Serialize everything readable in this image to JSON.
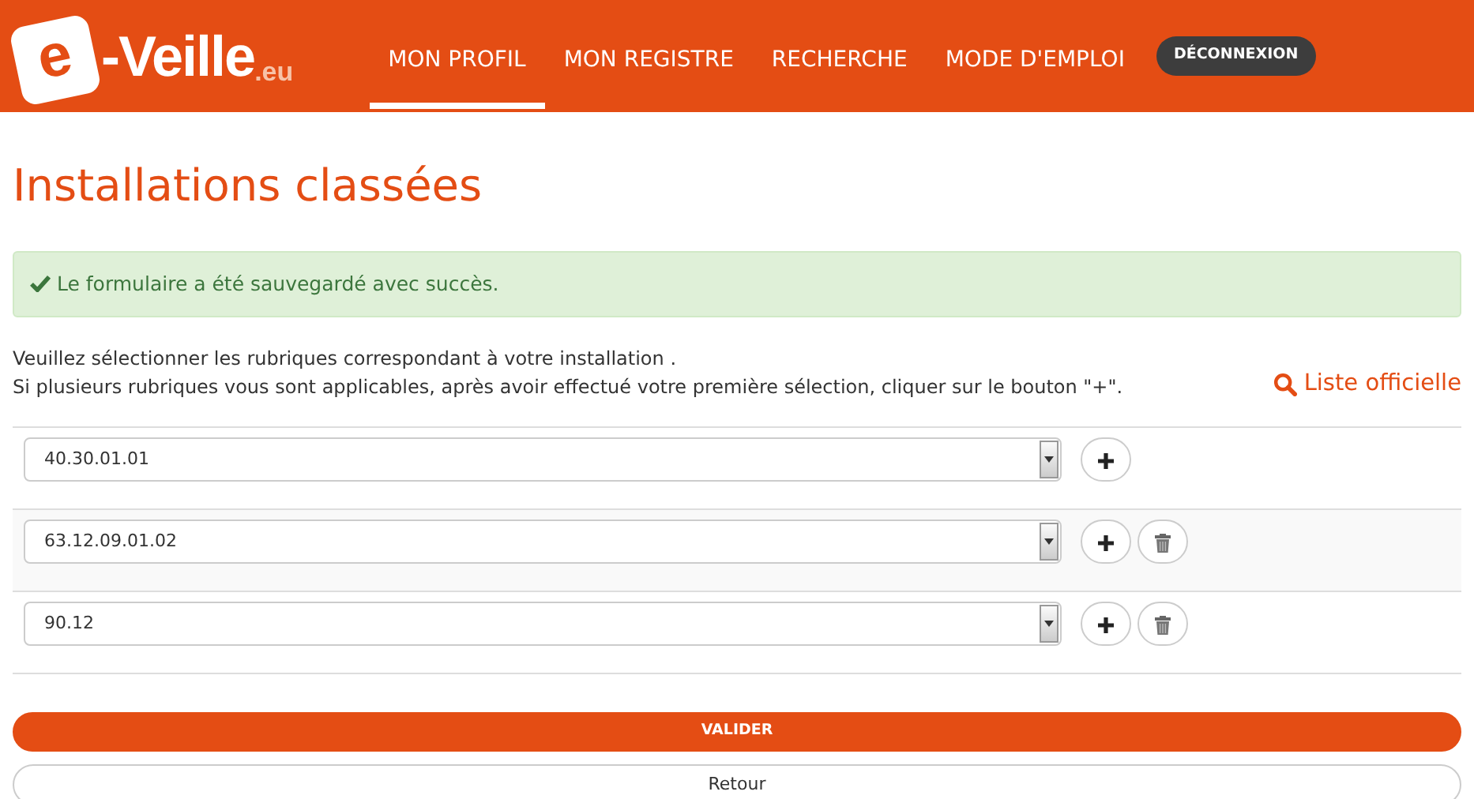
{
  "logo": {
    "initial": "e",
    "name": "-Veille",
    "suffix": ".eu"
  },
  "nav": [
    {
      "label": "MON PROFIL",
      "selected": true
    },
    {
      "label": "MON REGISTRE",
      "selected": false
    },
    {
      "label": "RECHERCHE",
      "selected": false
    },
    {
      "label": "MODE D'EMPLOI",
      "selected": false
    }
  ],
  "logout": "DÉCONNEXION",
  "title": "Installations classées",
  "alert": "Le formulaire a été sauvegardé avec succès.",
  "instructions": [
    "Veuillez sélectionner les rubriques correspondant à votre installation .",
    "Si plusieurs rubriques vous sont applicables, après avoir effectué votre première sélection, cliquer sur le bouton \"+\"."
  ],
  "official_list": "Liste officielle",
  "rubriques": [
    {
      "value": "40.30.01.01",
      "deletable": false
    },
    {
      "value": "63.12.09.01.02",
      "deletable": true
    },
    {
      "value": "90.12",
      "deletable": true
    }
  ],
  "buttons": {
    "submit": "VALIDER",
    "back": "Retour"
  }
}
